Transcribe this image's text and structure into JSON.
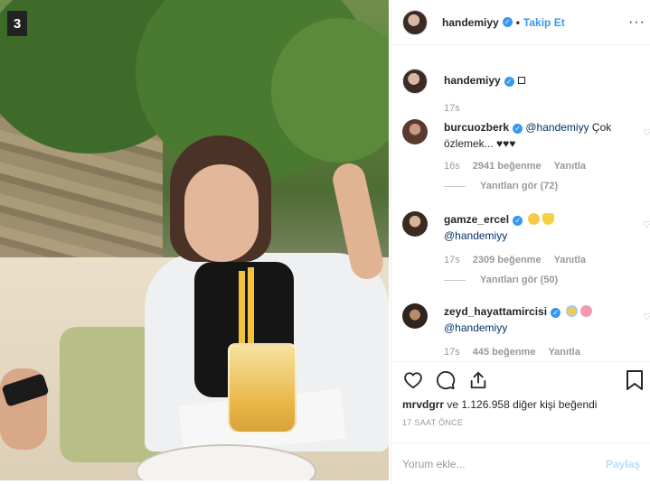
{
  "photo": {
    "badge": "3"
  },
  "header": {
    "username": "handemiyy",
    "separator": "•",
    "follow_label": "Takip Et",
    "more_label": "···"
  },
  "caption": {
    "username": "handemiyy",
    "time": "17s"
  },
  "comments": [
    {
      "username": "burcuozberk",
      "mention": "@handemiyy",
      "text_after_mention": " Çok özlemek... ♥♥♥",
      "time": "16s",
      "likes": "2941 beğenme",
      "reply_label": "Yanıtla",
      "view_replies": "Yanıtları gör (72)"
    },
    {
      "username": "gamze_ercel",
      "mention": "@handemiyy",
      "text_after_mention": "",
      "time": "17s",
      "likes": "2309 beğenme",
      "reply_label": "Yanıtla",
      "view_replies": "Yanıtları gör (50)"
    },
    {
      "username": "zeyd_hayattamircisi",
      "mention": "@handemiyy",
      "text_after_mention": "",
      "time": "17s",
      "likes": "445 beğenme",
      "reply_label": "Yanıtla"
    }
  ],
  "likes_summary": {
    "first_user": "mrvdgrr",
    "rest": " ve 1.126.958 diğer kişi beğendi"
  },
  "timestamp": "17 SAAT ÖNCE",
  "add_comment": {
    "placeholder": "Yorum ekle...",
    "post_label": "Paylaş"
  },
  "colors": {
    "accent": "#3897f0",
    "muted": "#999999",
    "mention": "#003569"
  }
}
